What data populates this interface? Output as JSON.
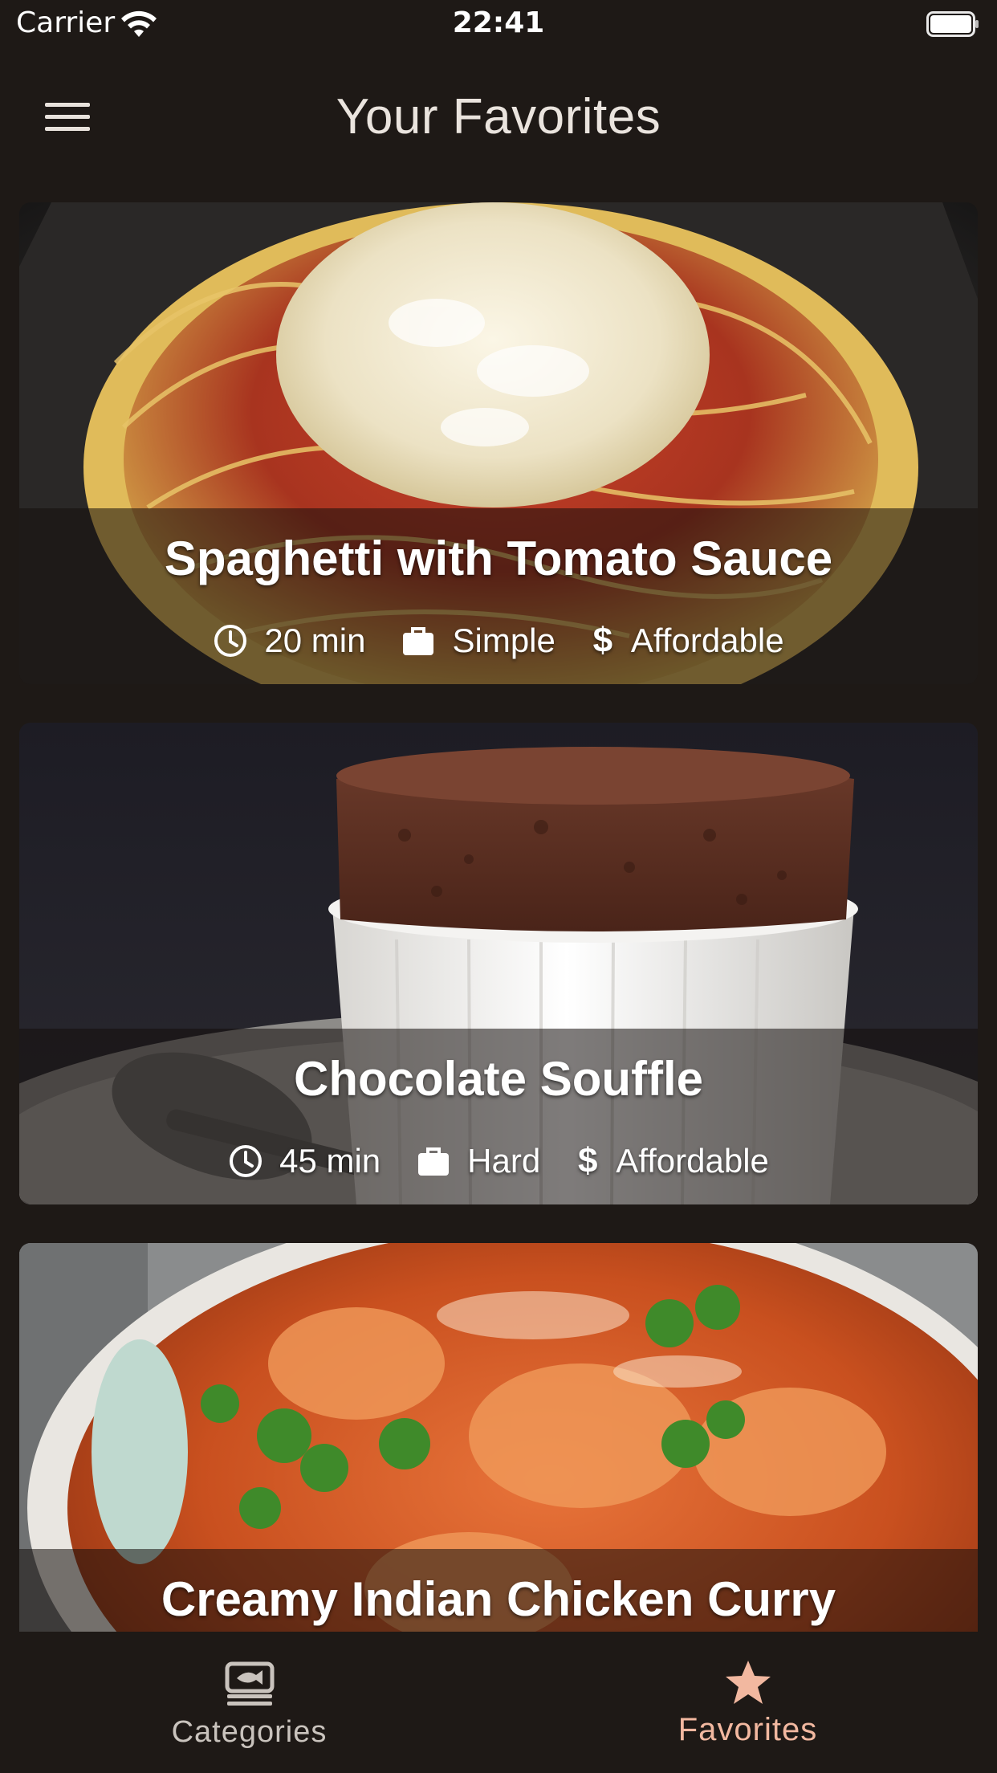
{
  "status_bar": {
    "carrier": "Carrier",
    "time": "22:41",
    "wifi_icon": "wifi-icon",
    "battery_icon": "battery-icon"
  },
  "app_bar": {
    "menu_icon": "hamburger-menu-icon",
    "title": "Your Favorites"
  },
  "meals": [
    {
      "title": "Spaghetti with Tomato Sauce",
      "duration": "20 min",
      "complexity": "Simple",
      "affordability": "Affordable",
      "currency_symbol": "$"
    },
    {
      "title": "Chocolate Souffle",
      "duration": "45 min",
      "complexity": "Hard",
      "affordability": "Affordable",
      "currency_symbol": "$"
    },
    {
      "title": "Creamy Indian Chicken Curry",
      "duration": "",
      "complexity": "",
      "affordability": "",
      "currency_symbol": ""
    }
  ],
  "tab_bar": {
    "tabs": [
      {
        "label": "Categories",
        "icon": "categories-icon",
        "active": false
      },
      {
        "label": "Favorites",
        "icon": "star-icon",
        "active": true
      }
    ],
    "active_color": "#f2b8a0",
    "inactive_color": "#c9c3bd"
  },
  "colors": {
    "background": "#1e1916",
    "title_text": "#eae4de"
  }
}
